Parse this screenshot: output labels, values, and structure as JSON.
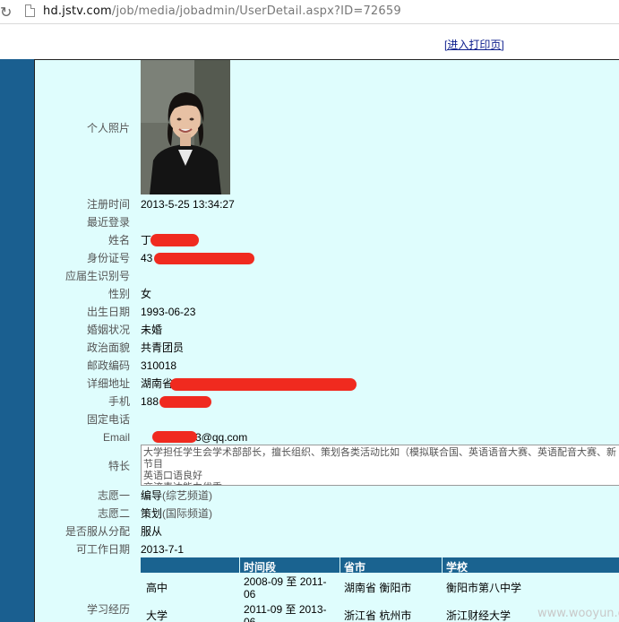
{
  "browser": {
    "url_host": "hd.jstv.com",
    "url_path": "/job/media/jobadmin/UserDetail.aspx?ID=72659"
  },
  "print_link": "[进入打印页]",
  "fields": {
    "photo": {
      "label": "个人照片"
    },
    "register_time": {
      "label": "注册时间",
      "value": "2013-5-25 13:34:27"
    },
    "last_login": {
      "label": "最近登录",
      "value": ""
    },
    "name": {
      "label": "姓名",
      "value": "丁"
    },
    "id_number": {
      "label": "身份证号",
      "value": "43"
    },
    "graduate_id": {
      "label": "应届生识别号",
      "value": ""
    },
    "gender": {
      "label": "性别",
      "value": "女"
    },
    "birth_date": {
      "label": "出生日期",
      "value": "1993-06-23"
    },
    "marital": {
      "label": "婚姻状况",
      "value": "未婚"
    },
    "political": {
      "label": "政治面貌",
      "value": "共青团员"
    },
    "postcode": {
      "label": "邮政编码",
      "value": "310018"
    },
    "address": {
      "label": "详细地址",
      "value": "湖南省"
    },
    "mobile": {
      "label": "手机",
      "value": "188"
    },
    "phone": {
      "label": "固定电话",
      "value": ""
    },
    "email": {
      "label": "Email",
      "value_prefix": "",
      "value": "3@qq.com"
    },
    "skills": {
      "label": "特长",
      "value": "大学担任学生会学术部部长，擅长组织、策划各类活动比如（模拟联合国、英语语音大赛、英语配音大赛、新节目\n英语口语良好\n交流表达能力优秀"
    },
    "wish1": {
      "label": "志愿一",
      "value": "编导",
      "sub": "(综艺频道)"
    },
    "wish2": {
      "label": "志愿二",
      "value": "策划",
      "sub": "(国际频道)"
    },
    "obey": {
      "label": "是否服从分配",
      "value": "服从"
    },
    "available": {
      "label": "可工作日期",
      "value": "2013-7-1"
    },
    "education": {
      "label": "学习经历",
      "headers": [
        "时间段",
        "省市",
        "学校"
      ],
      "rows": [
        {
          "level": "高中",
          "period": "2008-09 至 2011-06",
          "province": "湖南省 衡阳市",
          "school": "衡阳市第八中学"
        },
        {
          "level": "大学",
          "period": "2011-09 至 2013-06",
          "province": "浙江省 杭州市",
          "school": "浙江财经大学"
        }
      ]
    }
  },
  "watermark": "www.wooyun.org",
  "colors": {
    "side_strip": "#1a5f90",
    "panel_bg": "#dffdfd",
    "table_header": "#1a6390",
    "redaction": "#f02a1f"
  }
}
